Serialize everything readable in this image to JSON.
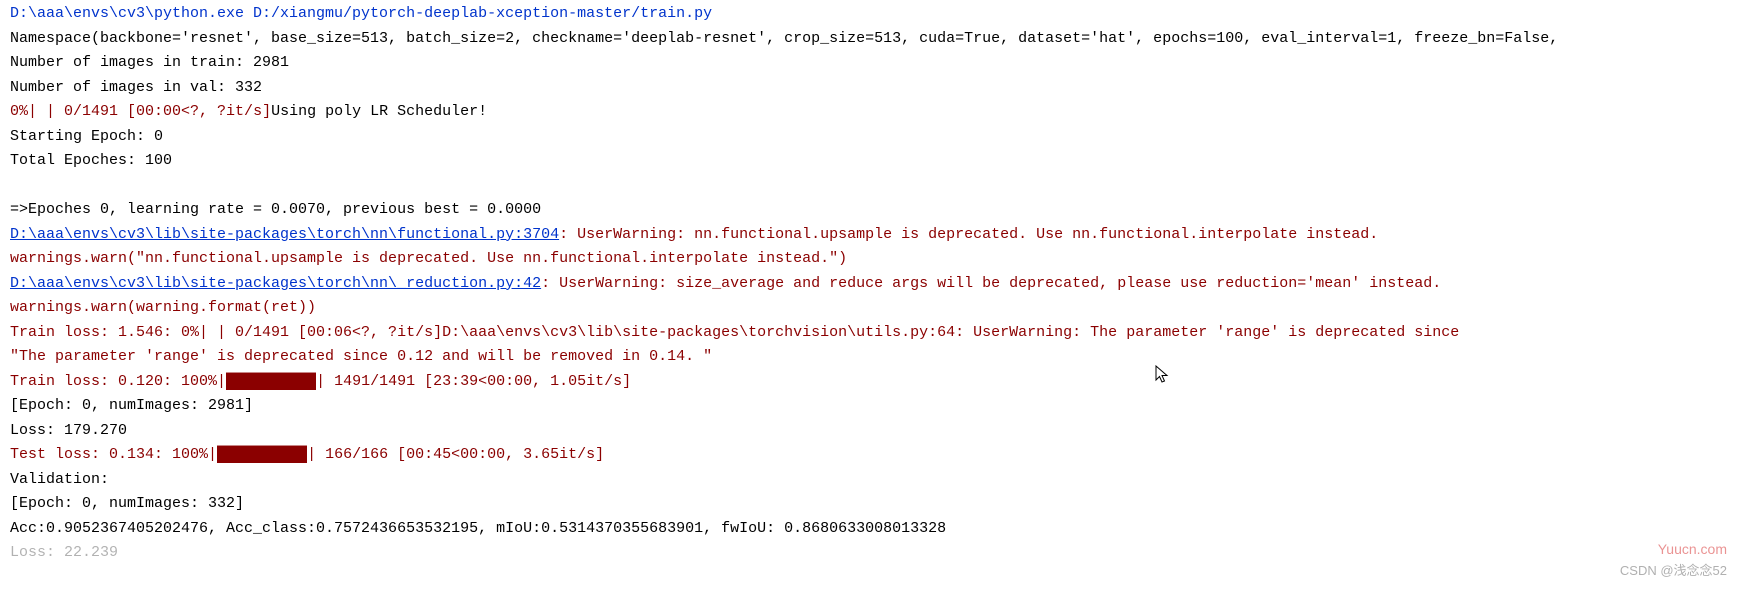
{
  "header": {
    "command": "D:\\aaa\\envs\\cv3\\python.exe D:/xiangmu/pytorch-deeplab-xception-master/train.py"
  },
  "namespace": "Namespace(backbone='resnet', base_size=513, batch_size=2, checkname='deeplab-resnet', crop_size=513, cuda=True, dataset='hat', epochs=100, eval_interval=1, freeze_bn=False,",
  "num_train": "Number of images in train: 2981",
  "num_val": "Number of images in val: 332",
  "progress_init": {
    "pct": "  0%",
    "bar_empty": "|          |",
    "counter": " 0/1491 [00:00<?, ?it/s]",
    "msg": "Using poly LR Scheduler!"
  },
  "start_epoch": "Starting Epoch: 0",
  "total_epochs": "Total Epoches: 100",
  "epoch_line": "=>Epoches 0, learning rate = 0.0070,               previous best = 0.0000",
  "warn1": {
    "link": "D:\\aaa\\envs\\cv3\\lib\\site-packages\\torch\\nn\\functional.py:3704",
    "msg": ": UserWarning: nn.functional.upsample is deprecated. Use nn.functional.interpolate instead.",
    "detail": "  warnings.warn(\"nn.functional.upsample is deprecated. Use nn.functional.interpolate instead.\")"
  },
  "warn2": {
    "link": "D:\\aaa\\envs\\cv3\\lib\\site-packages\\torch\\nn\\_reduction.py:42",
    "msg": ": UserWarning: size_average and reduce args will be deprecated, please use reduction='mean' instead.",
    "detail": "  warnings.warn(warning.format(ret))"
  },
  "train_loss1": {
    "prefix": "Train loss: 1.546:   0%|          | 0/1491 [00:06<?, ?it/s]",
    "suffix": "D:\\aaa\\envs\\cv3\\lib\\site-packages\\torchvision\\utils.py:64: UserWarning: The parameter 'range' is deprecated since"
  },
  "range_detail": "  \"The parameter 'range' is deprecated since 0.12 and will be removed in 0.14. \"",
  "train_loss2": {
    "prefix": "Train loss: 0.120: 100%|",
    "bar": "██████████",
    "suffix": "| 1491/1491 [23:39<00:00,  1.05it/s]"
  },
  "epoch_summary": "[Epoch: 0, numImages:  2981]",
  "loss_line": "Loss: 179.270",
  "test_loss": {
    "prefix": "Test loss: 0.134: 100%|",
    "bar": "██████████",
    "suffix": "| 166/166 [00:45<00:00,  3.65it/s]"
  },
  "validation": "Validation:",
  "val_epoch_summary": "[Epoch: 0, numImages:   332]",
  "metrics": "Acc:0.9052367405202476, Acc_class:0.7572436653532195, mIoU:0.5314370355683901, fwIoU: 0.8680633008013328",
  "partial_loss": "Loss: 22.239",
  "watermark1": "Yuucn.com",
  "watermark2": "CSDN @浅念念52"
}
